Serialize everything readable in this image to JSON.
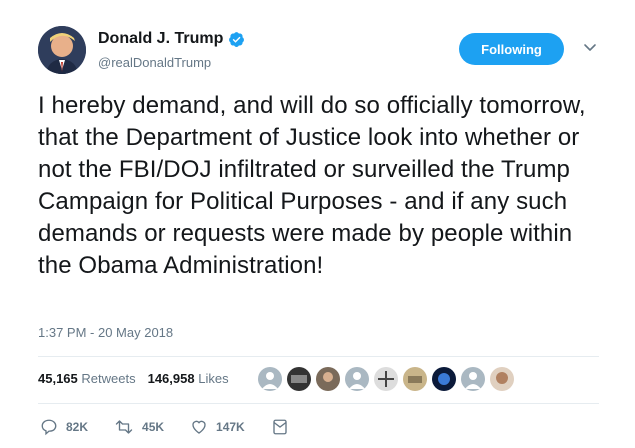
{
  "user": {
    "display_name": "Donald J. Trump",
    "handle": "@realDonaldTrump",
    "avatar_icon": "profile-photo",
    "verified_icon": "verified-badge-icon"
  },
  "follow_button": {
    "label": "Following"
  },
  "tweet": {
    "text": "I hereby demand, and will do so officially tomorrow, that the Department of Justice look into whether or not the FBI/DOJ infiltrated or surveilled the Trump Campaign for Political Purposes - and if any such demands or requests were made by people within the Obama Administration!",
    "timestamp": "1:37 PM - 20 May 2018"
  },
  "stats": {
    "retweets_count": "45,165",
    "retweets_label": "Retweets",
    "likes_count": "146,958",
    "likes_label": "Likes"
  },
  "actions": {
    "replies": "82K",
    "retweets": "45K",
    "likes": "147K"
  },
  "colors": {
    "accent": "#1da1f2",
    "text": "#14171a",
    "muted": "#657786"
  }
}
